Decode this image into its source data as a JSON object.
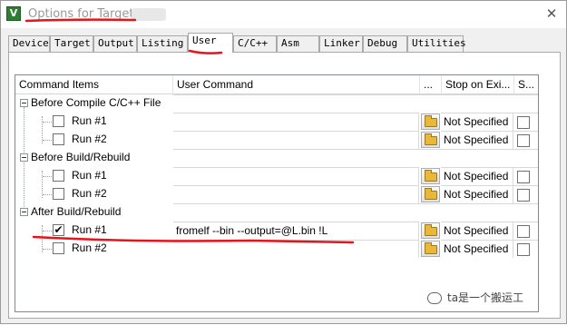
{
  "window": {
    "title": "Options for Target '",
    "close_symbol": "✕",
    "app_icon_glyph": "V"
  },
  "tabs": [
    {
      "label": "Device",
      "active": false
    },
    {
      "label": "Target",
      "active": false
    },
    {
      "label": "Output",
      "active": false
    },
    {
      "label": "Listing",
      "active": false
    },
    {
      "label": "User",
      "active": true
    },
    {
      "label": "C/C++",
      "active": false
    },
    {
      "label": "Asm",
      "active": false
    },
    {
      "label": "Linker",
      "active": false
    },
    {
      "label": "Debug",
      "active": false
    },
    {
      "label": "Utilities",
      "active": false
    }
  ],
  "grid": {
    "headers": {
      "command_items": "Command Items",
      "user_command": "User Command",
      "browse": "...",
      "stop_on_exit": "Stop on Exi...",
      "s": "S..."
    },
    "groups": [
      {
        "label": "Before Compile C/C++ File",
        "expander": "minus",
        "items": [
          {
            "label": "Run #1",
            "checked": false,
            "command": "",
            "stop": "Not Specified"
          },
          {
            "label": "Run #2",
            "checked": false,
            "command": "",
            "stop": "Not Specified"
          }
        ]
      },
      {
        "label": "Before Build/Rebuild",
        "expander": "minus",
        "items": [
          {
            "label": "Run #1",
            "checked": false,
            "command": "",
            "stop": "Not Specified"
          },
          {
            "label": "Run #2",
            "checked": false,
            "command": "",
            "stop": "Not Specified"
          }
        ]
      },
      {
        "label": "After Build/Rebuild",
        "expander": "minus",
        "items": [
          {
            "label": "Run #1",
            "checked": true,
            "command": "fromelf --bin --output=@L.bin !L",
            "stop": "Not Specified"
          },
          {
            "label": "Run #2",
            "checked": false,
            "command": "",
            "stop": "Not Specified"
          }
        ]
      }
    ],
    "check_glyph": "✔"
  },
  "watermark": {
    "text": "ta是一个搬运工",
    "icon": "wechat-icon"
  },
  "annotation_color": "#e8141c"
}
